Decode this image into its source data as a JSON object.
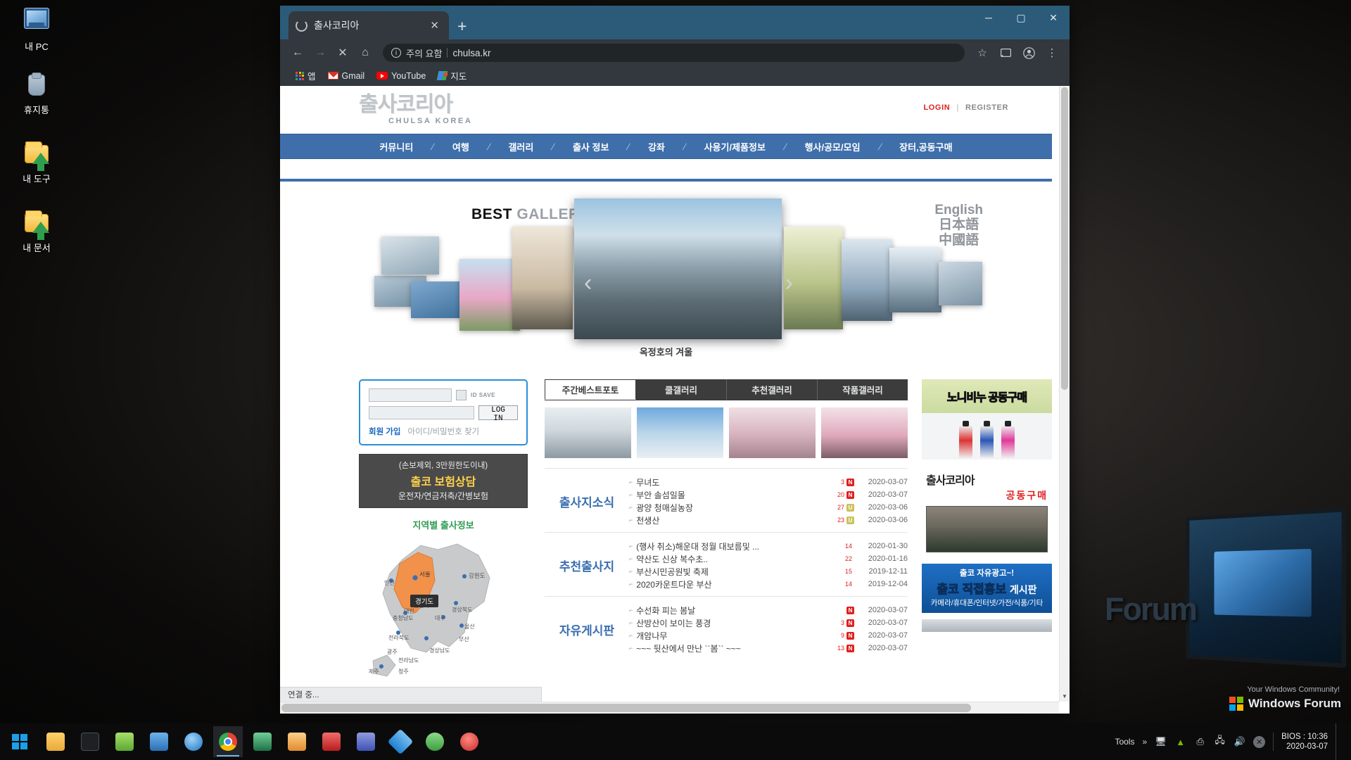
{
  "desktop": {
    "icons": [
      {
        "label": "내 PC",
        "icon": "my-computer-icon"
      },
      {
        "label": "휴지통",
        "icon": "recycle-bin-icon"
      },
      {
        "label": "내 도구",
        "icon": "folder-tools-icon"
      },
      {
        "label": "내 문서",
        "icon": "folder-documents-icon"
      }
    ],
    "wallpaper_text": {
      "forum": "Forum",
      "tagline": "Your Windows Community!",
      "logo": "Windows Forum"
    }
  },
  "browser": {
    "tab": {
      "title": "출사코리아",
      "favicon": "loading-spinner-icon",
      "close": "✕"
    },
    "new_tab": "+",
    "window_controls": {
      "minimize": "─",
      "maximize": "▢",
      "close": "✕"
    },
    "omnibox": {
      "back": "←",
      "forward": "→",
      "stop": "✕",
      "home": "⌂",
      "security_icon": "info-circle-icon",
      "security_text": "주의 요함",
      "url": "chulsa.kr",
      "bookmark_star": "☆",
      "cast": "cast-icon",
      "profile": "profile-avatar-icon",
      "menu": "⋮"
    },
    "bookmarks": [
      {
        "label": "앱",
        "icon": "apps-grid-icon"
      },
      {
        "label": "Gmail",
        "icon": "gmail-icon"
      },
      {
        "label": "YouTube",
        "icon": "youtube-icon"
      },
      {
        "label": "지도",
        "icon": "google-maps-icon"
      }
    ],
    "status_text": "연결 중..."
  },
  "site": {
    "logo": {
      "kr": "출사코리아",
      "en": "CHULSA KOREA"
    },
    "auth": {
      "login": "LOGIN",
      "separator": "|",
      "register": "REGISTER"
    },
    "nav": [
      "커뮤니티",
      "여행",
      "갤러리",
      "출사 정보",
      "강좌",
      "사용기/제품정보",
      "행사/공모/모임",
      "장터,공동구매"
    ],
    "hero": {
      "title_bold": "BEST",
      "title_light": "GALLERY",
      "prev": "‹",
      "next": "›",
      "caption": "옥정호의 겨울",
      "languages": [
        "English",
        "日本語",
        "中國語"
      ]
    },
    "login_box": {
      "id_placeholder": "",
      "id_value": "",
      "pw_placeholder": "",
      "pw_value": "",
      "id_save_label": "ID SAVE",
      "login_button": "LOG IN",
      "join": "회원 가입",
      "find": "아이디/비밀번호 찾기"
    },
    "insurance_banner": {
      "line1": "(손보제외, 3만원한도이내)",
      "line2": "출코 보험상담",
      "line3": "운전자/연금저축/간병보험"
    },
    "map": {
      "title": "지역별 출사정보",
      "tooltip": "경기도",
      "regions": [
        "인천",
        "서울",
        "강원도",
        "충청북도",
        "충청남도",
        "경상북도",
        "전라북도",
        "대구",
        "대전",
        "울산",
        "부산",
        "광주",
        "전라남도",
        "경상남도",
        "제주",
        "청주"
      ]
    },
    "gallery_tabs": [
      {
        "label": "주간베스트포토",
        "active": true
      },
      {
        "label": "쿨갤러리",
        "active": false
      },
      {
        "label": "추천갤러리",
        "active": false
      },
      {
        "label": "작품갤러리",
        "active": false
      }
    ],
    "thumbnails": [
      {
        "alt": "snow-temple-photo"
      },
      {
        "alt": "snow-mountain-peak-photo"
      },
      {
        "alt": "snow-cherry-blossom-photo"
      },
      {
        "alt": "pink-plum-blossom-photo"
      }
    ],
    "list_blocks": [
      {
        "title": "출사지소식",
        "items": [
          {
            "text": "무녀도",
            "count": "3",
            "badge": "N",
            "badge_type": "n",
            "date": "2020-03-07"
          },
          {
            "text": "부안 솔섬일몰",
            "count": "20",
            "badge": "N",
            "badge_type": "n",
            "date": "2020-03-07"
          },
          {
            "text": "광양 청매실농장",
            "count": "27",
            "badge": "U",
            "badge_type": "u",
            "date": "2020-03-06"
          },
          {
            "text": "천생산",
            "count": "23",
            "badge": "U",
            "badge_type": "u",
            "date": "2020-03-06"
          }
        ]
      },
      {
        "title": "추천출사지",
        "items": [
          {
            "text": "(행사 취소)해운대 정월 대보름및 ...",
            "count": "14",
            "badge": "",
            "badge_type": "",
            "date": "2020-01-30"
          },
          {
            "text": "약산도 신상 복수초..",
            "count": "22",
            "badge": "",
            "badge_type": "",
            "date": "2020-01-16"
          },
          {
            "text": "부산시민공원빛 축제",
            "count": "15",
            "badge": "",
            "badge_type": "",
            "date": "2019-12-11"
          },
          {
            "text": "2020카운트다운 부산",
            "count": "14",
            "badge": "",
            "badge_type": "",
            "date": "2019-12-04"
          }
        ]
      },
      {
        "title": "자유게시판",
        "items": [
          {
            "text": "수선화 피는 봄날",
            "count": "",
            "badge": "N",
            "badge_type": "n",
            "date": "2020-03-07"
          },
          {
            "text": "산방산이 보이는 풍경",
            "count": "3",
            "badge": "N",
            "badge_type": "n",
            "date": "2020-03-07"
          },
          {
            "text": "개암나무",
            "count": "9",
            "badge": "N",
            "badge_type": "n",
            "date": "2020-03-07"
          },
          {
            "text": "~~~ 뒷산에서 만난 ``봄`` ~~~",
            "count": "13",
            "badge": "N",
            "badge_type": "n",
            "date": "2020-03-07"
          }
        ]
      }
    ],
    "right_banners": {
      "soap": {
        "text": "노니비누 공동구매"
      },
      "bottles": {
        "alt": "three-bottle-product-banner"
      },
      "groupbuy": {
        "t1": "출사코리아",
        "t2": "공동구매",
        "alt": "bottles-warehouse-photo"
      },
      "ad": {
        "a1": "출코 자유광고~!",
        "a2_blue": "출코",
        "a2_dark": "직접홍보",
        "a2_tail": "게시판",
        "a3": "카메라/휴대폰/인터넷/가전/식품/기타"
      }
    }
  },
  "taskbar": {
    "start": "windows-start-icon",
    "items": [
      {
        "name": "file-explorer",
        "color": "#f2b93b"
      },
      {
        "name": "terminal",
        "color": "#2b2f33"
      },
      {
        "name": "notepad-plus",
        "color": "#8fd14f"
      },
      {
        "name": "media-app",
        "color": "#3f8ad8"
      },
      {
        "name": "internet-explorer",
        "color": "#1e8ad6"
      },
      {
        "name": "google-chrome",
        "color": "#ffffff"
      },
      {
        "name": "spreadsheet-app",
        "color": "#1e7145"
      },
      {
        "name": "paint-app",
        "color": "#e8a33d"
      },
      {
        "name": "pdf-reader",
        "color": "#c62828"
      },
      {
        "name": "settings-app",
        "color": "#5c6bc0"
      },
      {
        "name": "dropbox-app",
        "color": "#3d9ae8"
      },
      {
        "name": "green-app",
        "color": "#4caf50"
      },
      {
        "name": "power-app",
        "color": "#d32f2f"
      }
    ],
    "tools_label": "Tools",
    "overflow": "»",
    "tray": [
      {
        "name": "remote-desktop-icon"
      },
      {
        "name": "nvidia-icon"
      },
      {
        "name": "usb-safely-remove-icon"
      },
      {
        "name": "network-icon"
      },
      {
        "name": "volume-icon"
      },
      {
        "name": "action-center-icon"
      }
    ],
    "clock": {
      "line1": "BIOS : 10:36",
      "line2": "2020-03-07"
    }
  },
  "colors": {
    "nav_blue": "#3f6fab",
    "tab_blue": "#2b5b79",
    "accent_red": "#e02020",
    "list_title_blue": "#3a6fb0",
    "badge_new": "#e02020",
    "badge_update": "#c9c35a"
  }
}
